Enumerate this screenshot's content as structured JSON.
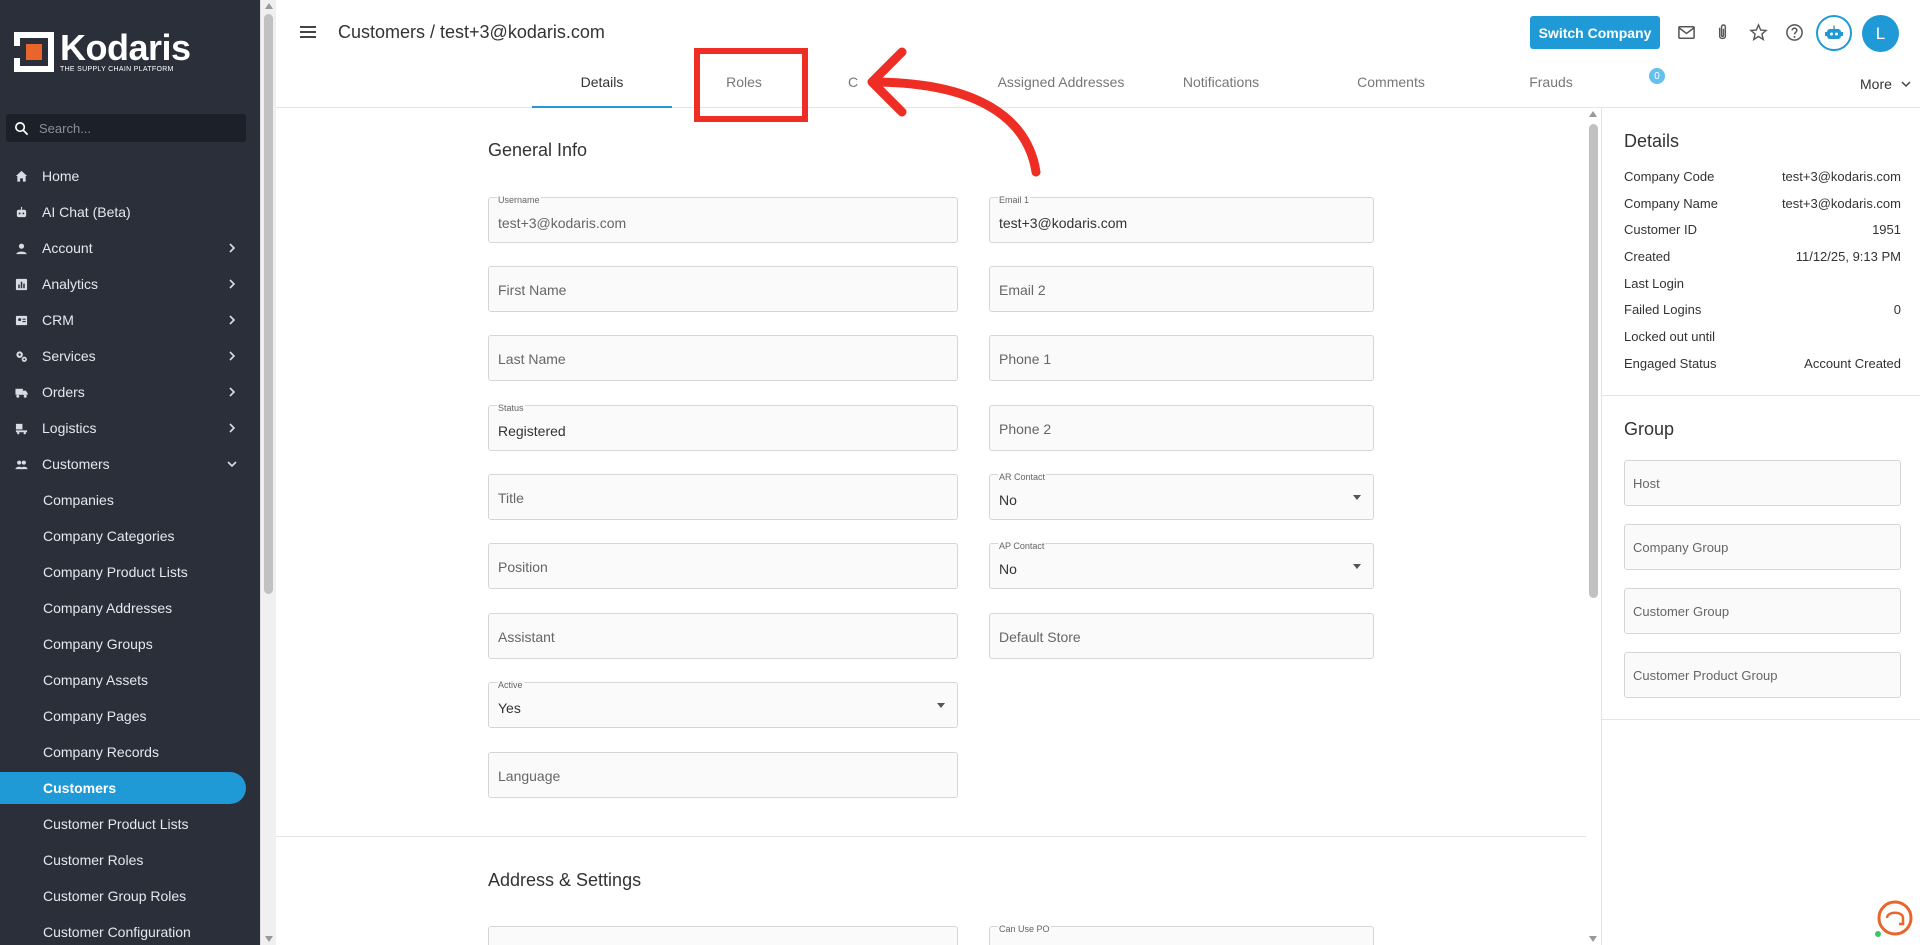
{
  "app": {
    "logo_text": "Kodaris",
    "logo_tagline": "THE SUPPLY CHAIN PLATFORM"
  },
  "sidebar": {
    "search_placeholder": "Search...",
    "items": [
      {
        "label": "Home",
        "icon": "home-icon"
      },
      {
        "label": "AI Chat (Beta)",
        "icon": "robot-icon"
      },
      {
        "label": "Account",
        "icon": "person-icon"
      },
      {
        "label": "Analytics",
        "icon": "chart-icon"
      },
      {
        "label": "CRM",
        "icon": "contact-card-icon"
      },
      {
        "label": "Services",
        "icon": "gears-icon"
      },
      {
        "label": "Orders",
        "icon": "truck-icon"
      },
      {
        "label": "Logistics",
        "icon": "delivery-icon"
      },
      {
        "label": "Customers",
        "icon": "people-icon"
      }
    ],
    "sub_items": [
      {
        "label": "Companies"
      },
      {
        "label": "Company Categories"
      },
      {
        "label": "Company Product Lists"
      },
      {
        "label": "Company Addresses"
      },
      {
        "label": "Company Groups"
      },
      {
        "label": "Company Assets"
      },
      {
        "label": "Company Pages"
      },
      {
        "label": "Company Records"
      },
      {
        "label": "Customers"
      },
      {
        "label": "Customer Product Lists"
      },
      {
        "label": "Customer Roles"
      },
      {
        "label": "Customer Group Roles"
      },
      {
        "label": "Customer Configuration"
      }
    ]
  },
  "header": {
    "title": "Customers / test+3@kodaris.com",
    "switch_company_label": "Switch Company",
    "avatar_initial": "L",
    "icons": [
      "mail-icon",
      "paperclip-icon",
      "star-icon",
      "help-icon"
    ]
  },
  "tabs": {
    "items": [
      {
        "label": "Details"
      },
      {
        "label": "Roles"
      },
      {
        "label": "C"
      },
      {
        "label": "Assigned Addresses"
      },
      {
        "label": "Notifications"
      },
      {
        "label": "Comments"
      },
      {
        "label": "Frauds"
      }
    ],
    "comments_badge": "0",
    "more_label": "More"
  },
  "general_info": {
    "title": "General Info",
    "username_label": "Username",
    "username_value": "test+3@kodaris.com",
    "email1_label": "Email 1",
    "email1_value": "test+3@kodaris.com",
    "first_name": "First Name",
    "email2": "Email 2",
    "last_name": "Last Name",
    "phone1": "Phone 1",
    "status_label": "Status",
    "status_value": "Registered",
    "phone2": "Phone 2",
    "title_field": "Title",
    "ar_contact_label": "AR Contact",
    "ar_contact_value": "No",
    "position": "Position",
    "ap_contact_label": "AP Contact",
    "ap_contact_value": "No",
    "assistant": "Assistant",
    "default_store": "Default Store",
    "active_label": "Active",
    "active_value": "Yes",
    "language": "Language"
  },
  "address_settings": {
    "title": "Address & Settings",
    "can_use_po_label": "Can Use PO"
  },
  "details_panel": {
    "title": "Details",
    "rows": [
      {
        "key": "Company Code",
        "value": "test+3@kodaris.com"
      },
      {
        "key": "Company Name",
        "value": "test+3@kodaris.com"
      },
      {
        "key": "Customer ID",
        "value": "1951"
      },
      {
        "key": "Created",
        "value": "11/12/25, 9:13 PM"
      },
      {
        "key": "Last Login",
        "value": ""
      },
      {
        "key": "Failed Logins",
        "value": "0"
      },
      {
        "key": "Locked out until",
        "value": ""
      },
      {
        "key": "Engaged Status",
        "value": "Account Created"
      }
    ]
  },
  "group_panel": {
    "title": "Group",
    "fields": [
      "Host",
      "Company Group",
      "Customer Group",
      "Customer Product Group"
    ]
  },
  "colors": {
    "accent": "#1f9ad6",
    "sidebar_bg": "#2a2f3a",
    "annotation_red": "#ee2d25"
  }
}
